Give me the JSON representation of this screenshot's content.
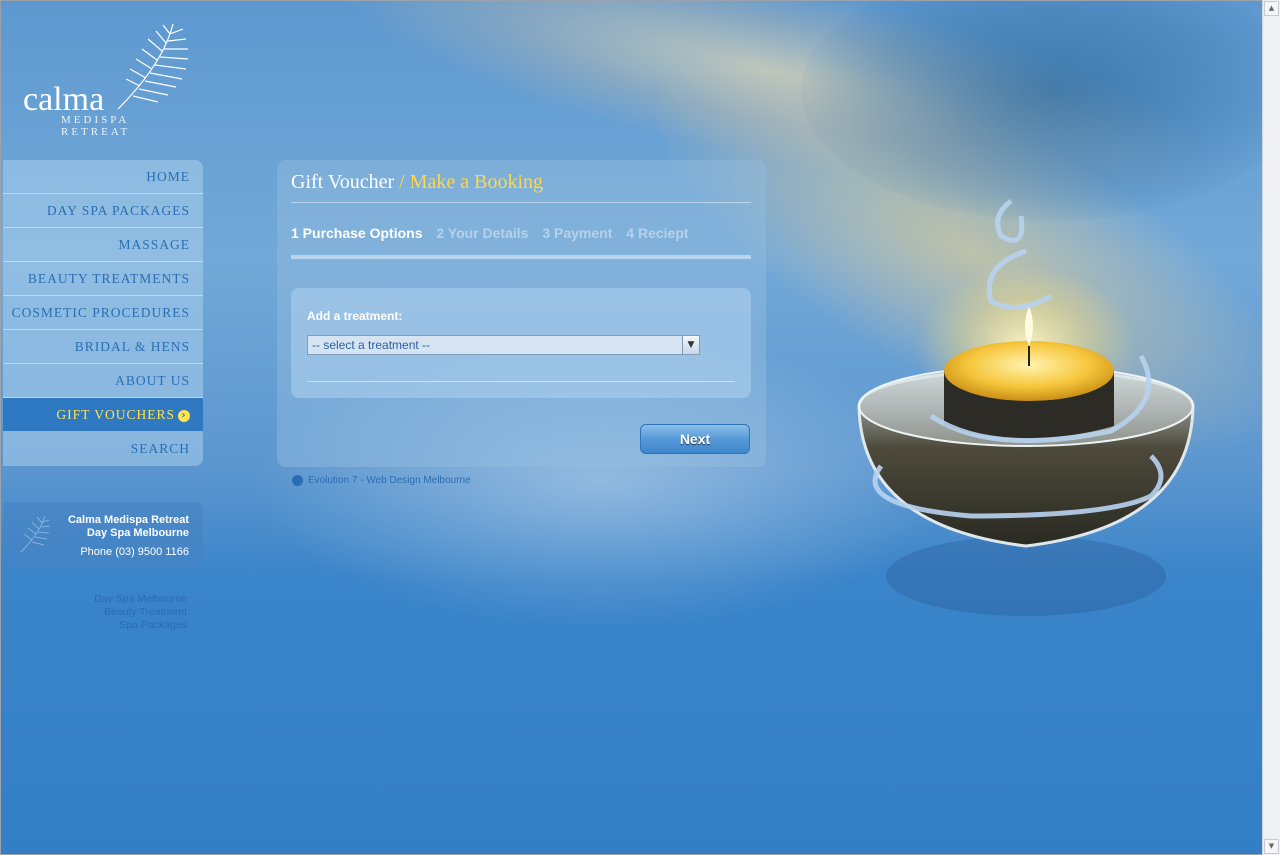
{
  "brand": {
    "name": "calma",
    "tagline": "MEDISPA RETREAT"
  },
  "nav": {
    "items": [
      {
        "label": "HOME"
      },
      {
        "label": "DAY SPA PACKAGES"
      },
      {
        "label": "MASSAGE"
      },
      {
        "label": "BEAUTY TREATMENTS"
      },
      {
        "label": "COSMETIC PROCEDURES"
      },
      {
        "label": "BRIDAL & HENS"
      },
      {
        "label": "ABOUT US"
      },
      {
        "label": "GIFT VOUCHERS"
      },
      {
        "label": "SEARCH"
      }
    ],
    "active": "GIFT VOUCHERS"
  },
  "contact": {
    "line1": "Calma Medispa Retreat",
    "line2": "Day Spa Melbourne",
    "phone": "Phone (03) 9500 1166"
  },
  "seo_links": [
    "Day Spa Melbourne",
    "Beauty Treatment",
    "Spa Packages"
  ],
  "main": {
    "title_main": "Gift Voucher",
    "title_sep": " / ",
    "title_highlight": "Make a Booking",
    "steps": [
      {
        "label": "1 Purchase Options"
      },
      {
        "label": "2 Your Details"
      },
      {
        "label": "3 Payment"
      },
      {
        "label": "4 Reciept"
      }
    ],
    "current_step": 1,
    "add_label": "Add a treatment:",
    "select_value": "-- select a treatment --",
    "next_label": "Next"
  },
  "credit": "Evolution 7 - Web Design Melbourne",
  "colors": {
    "accent_yellow": "#ffd84a",
    "nav_text": "#2a6fb4",
    "active_bg": "#2f78c2"
  }
}
